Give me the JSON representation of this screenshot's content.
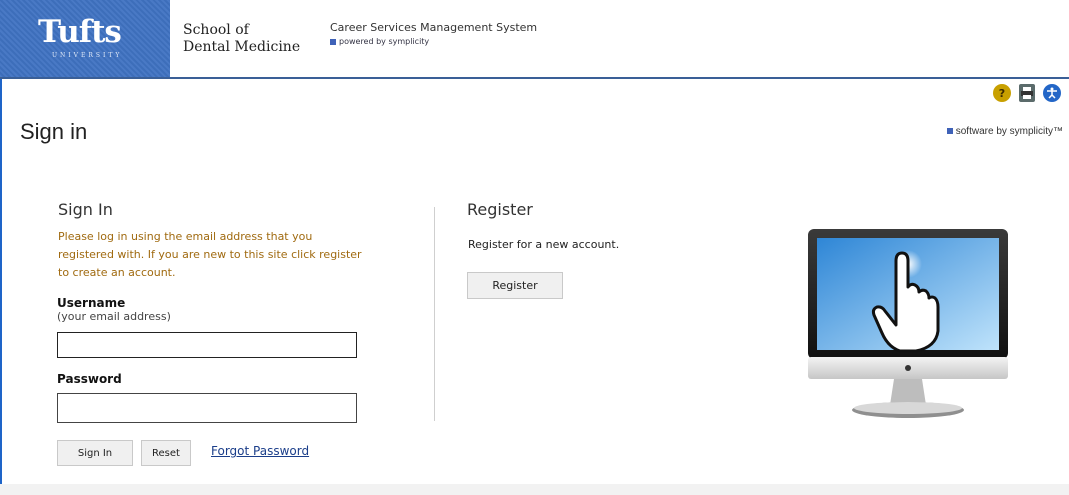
{
  "header": {
    "logo_text": "Tufts",
    "logo_subtext": "UNIVERSITY",
    "school_line1": "School of",
    "school_line2": "Dental Medicine",
    "system_title": "Career Services Management System",
    "powered_by": "powered by symplicity"
  },
  "page": {
    "title": "Sign in",
    "software_by": "software by symplicity™"
  },
  "signin": {
    "heading": "Sign In",
    "instructions": "Please log in using the email address that you registered with. If you are new to this site click register to create an account.",
    "username_label": "Username",
    "username_hint": "(your email address)",
    "username_value": "",
    "password_label": "Password",
    "password_value": "",
    "signin_button": "Sign In",
    "reset_button": "Reset",
    "forgot_link": "Forgot Password"
  },
  "register": {
    "heading": "Register",
    "text": "Register for a new account.",
    "button": "Register"
  },
  "icons": {
    "help": "help-icon",
    "print": "print-icon",
    "accessibility": "accessibility-icon"
  },
  "colors": {
    "brand_blue": "#3f72c2",
    "instruction_text": "#a06a10",
    "link": "#1b3e8a"
  }
}
